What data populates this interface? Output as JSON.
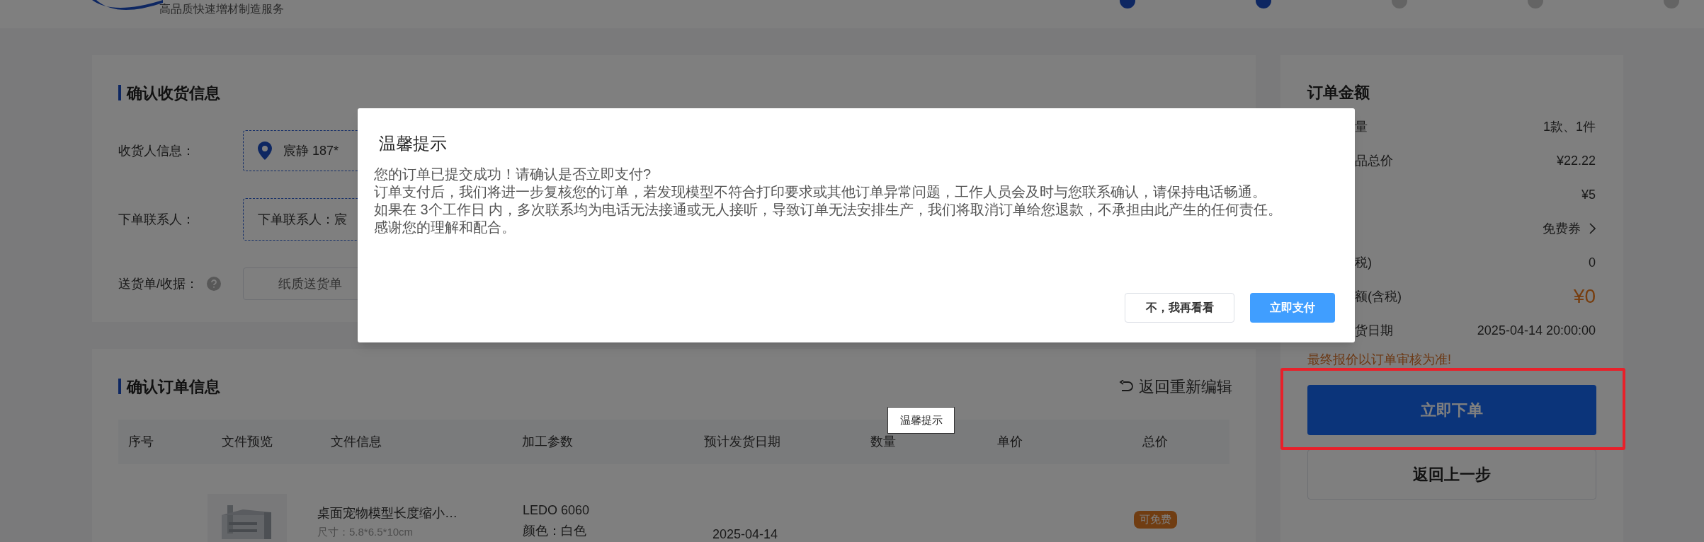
{
  "header": {
    "subtitle": "高品质快速增材制造服务",
    "steps": [
      {
        "completed": true
      },
      {
        "completed": true
      },
      {
        "completed": false
      },
      {
        "completed": false
      },
      {
        "completed": false
      }
    ]
  },
  "shipping_panel": {
    "title": "确认收货信息",
    "rows": [
      {
        "kind": "address",
        "label": "收货人信息：",
        "value": "宸静 187*"
      },
      {
        "kind": "contact",
        "label": "下单联系人：",
        "value": "下单联系人：宸"
      },
      {
        "kind": "receipt",
        "label": "送货单/收据：",
        "value": "纸质送货单"
      }
    ]
  },
  "order_panel": {
    "title": "确认订单信息",
    "back_link": "返回重新编辑",
    "columns": [
      "序号",
      "文件预览",
      "文件信息",
      "加工参数",
      "预计发货日期",
      "数量",
      "单价",
      "总价"
    ],
    "rows": [
      {
        "file_name": "桌面宠物模型长度缩小…",
        "size": "尺寸：5.8*6.5*10cm",
        "material": "LEDO 6060",
        "color_text": "颜色：白色",
        "ship_date": "2025-04-14",
        "badge": "可免费"
      }
    ]
  },
  "summary": {
    "title": "订单金额",
    "rows": [
      {
        "kind": "plain",
        "label": "量",
        "value": "1款、1件"
      },
      {
        "kind": "plain",
        "label": "品总价",
        "value": "¥22.22"
      },
      {
        "kind": "plain",
        "value": "¥5"
      },
      {
        "kind": "coupon",
        "value": "免费券"
      },
      {
        "kind": "plain",
        "label": "税)",
        "value": "0"
      },
      {
        "kind": "total",
        "label": "额(含税)",
        "value": "¥0"
      },
      {
        "kind": "plain",
        "label": "货日期",
        "value": "2025-04-14 20:00:00"
      }
    ],
    "note": "最终报价以订单审核为准!",
    "primary_button": "立即下单",
    "secondary_button": "返回上一步",
    "primary_highlighted": true
  },
  "tooltip": {
    "text": "温馨提示"
  },
  "modal": {
    "title": "温馨提示",
    "paragraphs": [
      "您的订单已提交成功！请确认是否立即支付?",
      "订单支付后，我们将进一步复核您的订单，若发现模型不符合打印要求或其他订单异常问题，工作人员会及时与您联系确认，请保持电话畅通。",
      "如果在 3个工作日 内，多次联系均为电话无法接通或无人接听，导致订单无法安排生产，我们将取消订单给您退款，不承担由此产生的任何责任。",
      "感谢您的理解和配合。"
    ],
    "cancel_button": "不，我再看看",
    "confirm_button": "立即支付"
  }
}
